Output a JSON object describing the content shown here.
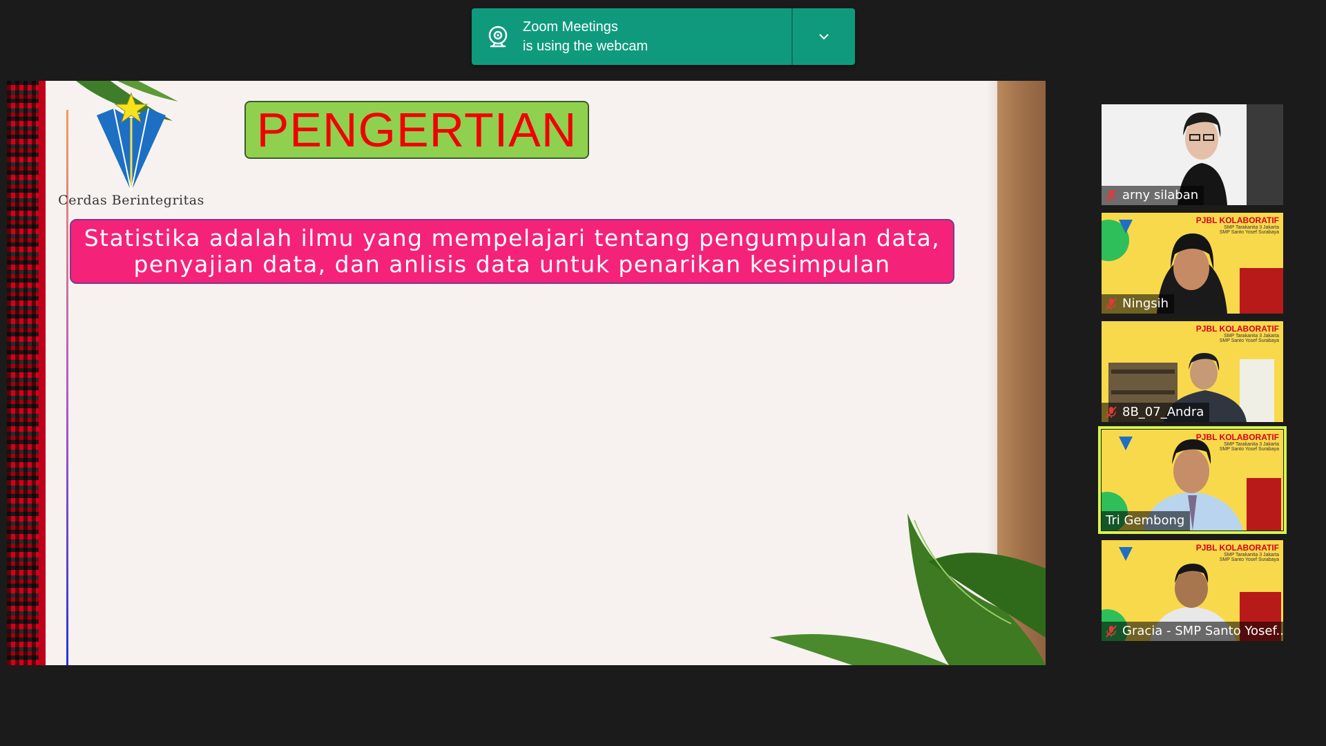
{
  "notification": {
    "line1": "Zoom Meetings",
    "line2": "is using the webcam",
    "icon": "webcam-icon",
    "color": "#0f9a7e"
  },
  "slide": {
    "logo_text": "Cerdas Berintegritas",
    "title": "PENGERTIAN",
    "definition_line1": "Statistika adalah ilmu yang mempelajari tentang pengumpulan data,",
    "definition_line2": "penyajian data, dan anlisis data untuk penarikan kesimpulan",
    "colors": {
      "title_bg": "#8fd14f",
      "title_text": "#f00000",
      "definition_bg": "#f5227a"
    }
  },
  "participants": [
    {
      "name": "arny silaban",
      "muted": true,
      "active": false,
      "banner": ""
    },
    {
      "name": "Ningsih",
      "muted": true,
      "active": false,
      "banner": "PJBL KOLABORATIF",
      "banner_sub1": "SMP Tarakanita 3 Jakarta",
      "banner_sub2": "SMP Santo Yosef Surabaya"
    },
    {
      "name": "8B_07_Andra",
      "muted": true,
      "active": false,
      "banner": "PJBL KOLABORATIF",
      "banner_sub1": "SMP Tarakanita 3 Jakarta",
      "banner_sub2": "SMP Santo Yosef Surabaya"
    },
    {
      "name": "Tri Gembong",
      "muted": false,
      "active": true,
      "banner": "PJBL KOLABORATIF",
      "banner_sub1": "SMP Tarakanita 3 Jakarta",
      "banner_sub2": "SMP Santo Yosef Surabaya"
    },
    {
      "name": "Gracia - SMP Santo Yosef...",
      "muted": true,
      "active": false,
      "banner": "PJBL KOLABORATIF",
      "banner_sub1": "SMP Tarakanita 3 Jakarta",
      "banner_sub2": "SMP Santo Yosef Surabaya"
    }
  ]
}
